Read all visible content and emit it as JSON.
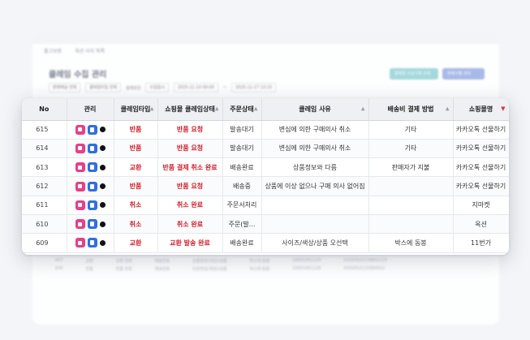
{
  "bg": {
    "links": [
      "출고보류",
      "옥션 사지 목록"
    ],
    "title": "클레임 수집 관리",
    "btn_a": "클레임 수집기록 조회",
    "btn_b": "판매사별 관리",
    "filter_channel": "판매채널 전체",
    "filter_type": "클레임타입 전체",
    "filter_cond_label": "검색조건",
    "filter_cond": "수집일시",
    "date_from": "2025-11-10 00:00",
    "date_sep": "~",
    "date_to": "2025-11-17 13:15",
    "rows": [
      [
        "607",
        "교환",
        "교환 완료",
        "배송완료",
        "상품정보(색상)/상품",
        "박스에 동봉",
        "10001451129",
        "20250920238891025"
      ],
      [
        "606",
        "반품",
        "반품 완료",
        "배송완료",
        "단순변심(색상)/상품",
        "박스에 동봉",
        "10001451128",
        "2025052119384910"
      ]
    ]
  },
  "table": {
    "headers": {
      "no": "No",
      "mgmt": "관리",
      "claim_type": "클레임타입",
      "mall_state": "쇼핑몰 클레임상태",
      "order_state": "주문상태",
      "reason": "클레임 사유",
      "shipping_pay": "배송비 결제 방법",
      "mall_name": "쇼핑몰명"
    },
    "rows": [
      {
        "no": "615",
        "claim_type": "반품",
        "mall_state": "반품 요청",
        "order_state": "발송대기",
        "reason": "변심에 의한 구매의사 취소",
        "shipping_pay": "기타",
        "mall_name": "카카오톡 선물하기"
      },
      {
        "no": "614",
        "claim_type": "반품",
        "mall_state": "반품 요청",
        "order_state": "발송대기",
        "reason": "변심에 의한 구매의사 취소",
        "shipping_pay": "기타",
        "mall_name": "카카오톡 선물하기"
      },
      {
        "no": "613",
        "claim_type": "교환",
        "mall_state": "반품 결제 취소 완료",
        "order_state": "배송완료",
        "reason": "상품정보와 다름",
        "shipping_pay": "판매자가 지불",
        "mall_name": "카카오톡 선물하기"
      },
      {
        "no": "612",
        "claim_type": "반품",
        "mall_state": "반품 요청",
        "order_state": "배송중",
        "reason": "상품에 이상 없으나 구매 의사 없어짐",
        "shipping_pay": "",
        "mall_name": "카카오톡 선물하기"
      },
      {
        "no": "611",
        "claim_type": "취소",
        "mall_state": "취소 완료",
        "order_state": "주문서처리",
        "reason": "",
        "shipping_pay": "",
        "mall_name": "지마켓"
      },
      {
        "no": "610",
        "claim_type": "취소",
        "mall_state": "취소 완료",
        "order_state": "주문(발...",
        "reason": "",
        "shipping_pay": "",
        "mall_name": "옥션"
      },
      {
        "no": "609",
        "claim_type": "교환",
        "mall_state": "교환 발송 완료",
        "order_state": "배송완료",
        "reason": "사이즈/색상/상품 오선택",
        "shipping_pay": "박스에 동봉",
        "mall_name": "11번가"
      }
    ]
  },
  "colors": {
    "accent_red": "#d4202c",
    "pink_icon": "#ea3d8a",
    "blue_icon": "#2f6fe0"
  },
  "icons": {
    "edit": "memo-icon",
    "detail": "document-icon",
    "status": "status-dot-icon"
  }
}
